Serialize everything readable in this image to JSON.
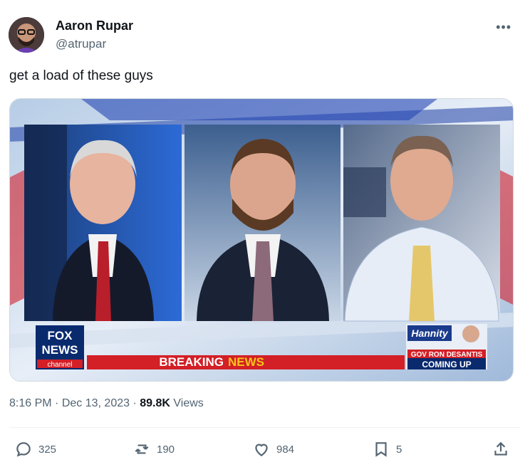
{
  "author": {
    "name": "Aaron Rupar",
    "handle": "@atrupar"
  },
  "more_label": "•••",
  "tweet": {
    "text": "get a load of these guys"
  },
  "media": {
    "network": "FOX",
    "network2": "NEWS",
    "channel": "channel",
    "breaking_1": "BREAKING",
    "breaking_2": "NEWS",
    "promo_show": "Hannity",
    "promo_line1": "GOV RON DESANTIS",
    "promo_line2": "COMING UP"
  },
  "meta": {
    "time": "8:16 PM",
    "date": "Dec 13, 2023",
    "views_count": "89.8K",
    "views_label": "Views",
    "sep": "·"
  },
  "actions": {
    "replies": "325",
    "reposts": "190",
    "likes": "984",
    "bookmarks": "5"
  },
  "colors": {
    "breaking_red": "#d31f26",
    "breaking_yellow": "#f5c518",
    "fox_blue": "#0a2a6e",
    "text_secondary": "#536471"
  }
}
